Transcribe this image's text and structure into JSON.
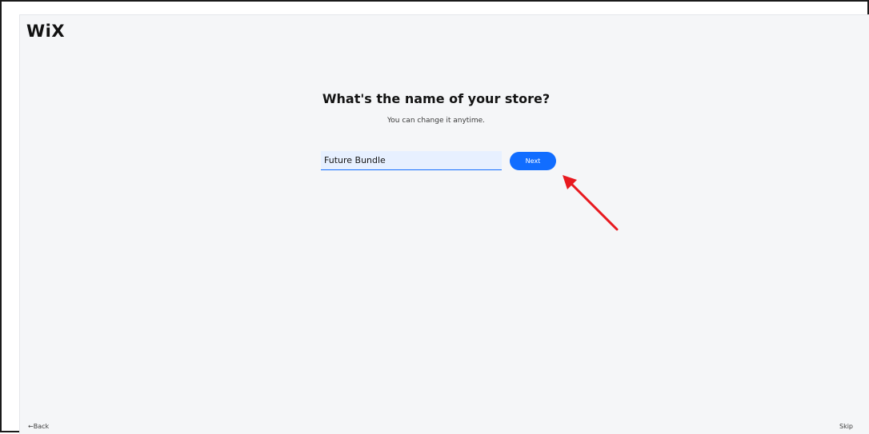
{
  "header": {
    "logo_text": "WiX"
  },
  "main": {
    "title": "What's the name of your store?",
    "subtitle": "You can change it anytime.",
    "store_name_value": "Future Bundle",
    "next_label": "Next"
  },
  "footer": {
    "back_label": "←Back",
    "skip_label": "Skip"
  },
  "annotation": {
    "arrow_icon": "arrow-pointer-icon",
    "arrow_color": "#e8191f"
  },
  "colors": {
    "accent": "#116dff",
    "background": "#f5f6f8"
  }
}
